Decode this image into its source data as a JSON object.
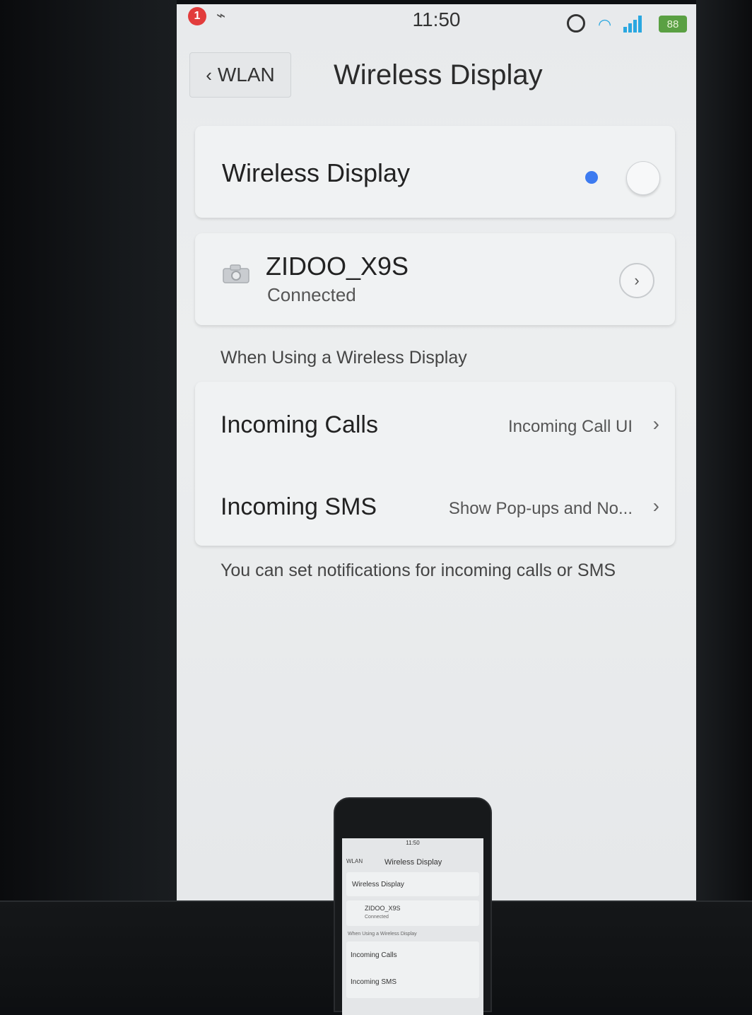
{
  "status_bar": {
    "notification_count": "1",
    "time": "11:50",
    "battery": "88",
    "icons": [
      "usb-icon",
      "alarm-icon",
      "wifi-icon",
      "signal-icon"
    ]
  },
  "nav": {
    "back_label": "WLAN",
    "title": "Wireless Display"
  },
  "wireless_toggle": {
    "label": "Wireless Display",
    "state": "on"
  },
  "device": {
    "name": "ZIDOO_X9S",
    "status": "Connected"
  },
  "section_header": "When Using a Wireless Display",
  "settings": [
    {
      "title": "Incoming Calls",
      "value": "Incoming Call UI"
    },
    {
      "title": "Incoming SMS",
      "value": "Show Pop-ups and No..."
    }
  ],
  "footer_note": "You can set notifications for incoming calls or SMS",
  "colors": {
    "accent_blue": "#3d7bf0",
    "battery_green": "#5aa043",
    "notification_red": "#e23c3c",
    "signal_blue": "#2aa7e0"
  }
}
